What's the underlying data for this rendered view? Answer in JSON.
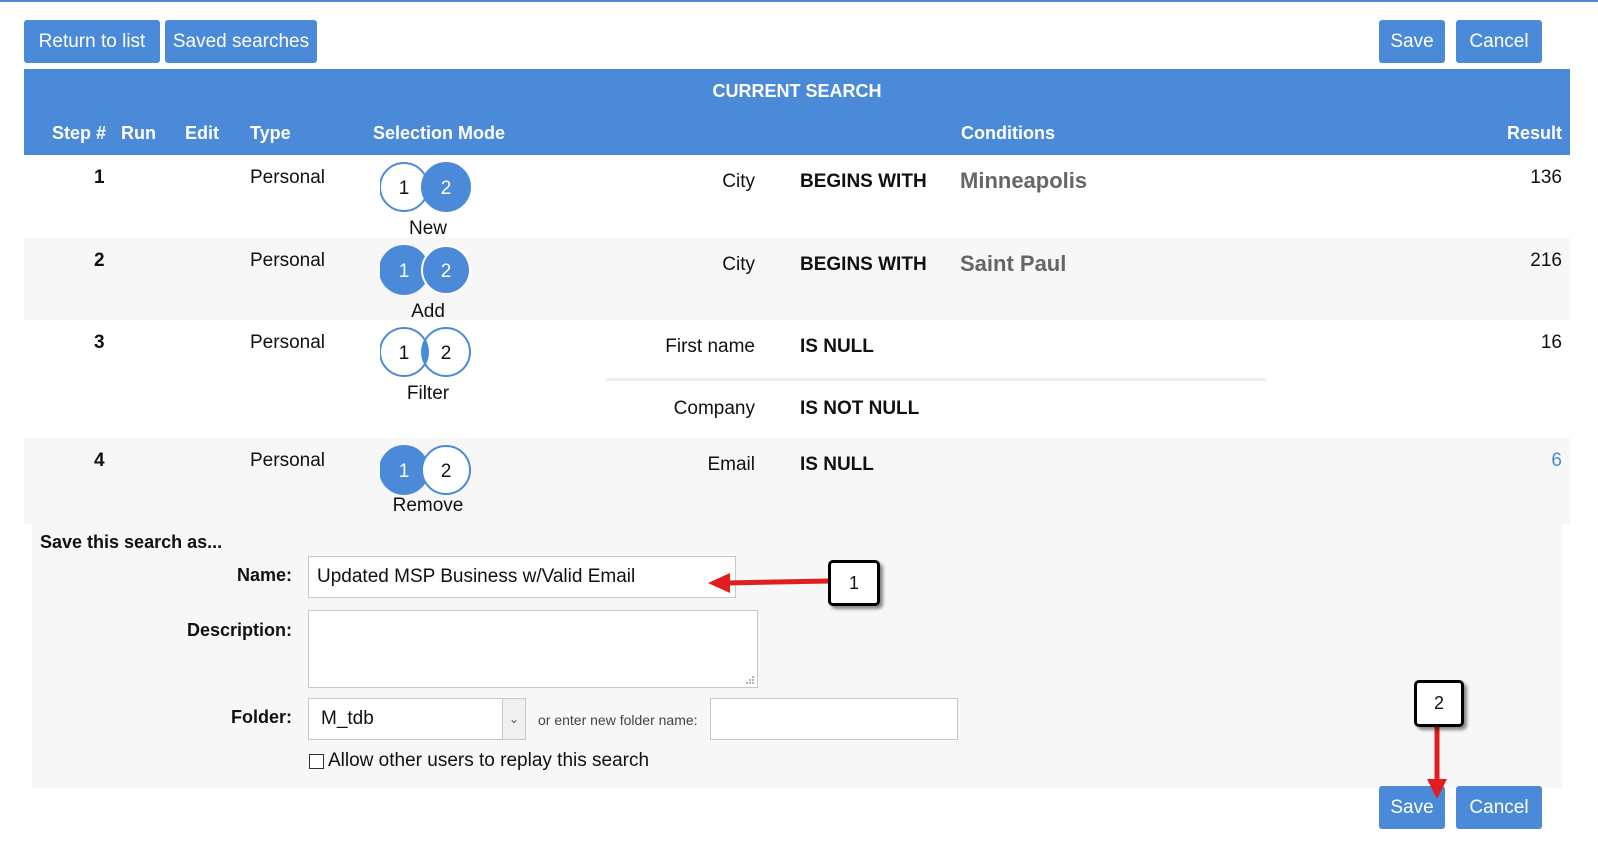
{
  "toolbar": {
    "return_label": "Return to list",
    "saved_label": "Saved searches",
    "save_label": "Save",
    "cancel_label": "Cancel"
  },
  "table": {
    "title": "CURRENT SEARCH",
    "columns": {
      "step": "Step #",
      "run": "Run",
      "edit": "Edit",
      "type": "Type",
      "mode": "Selection Mode",
      "conditions": "Conditions",
      "result": "Result"
    },
    "rows": [
      {
        "step": "1",
        "type": "Personal",
        "mode": "New",
        "conditions": [
          {
            "field": "City",
            "op": "BEGINS WITH",
            "value": "Minneapolis"
          }
        ],
        "result": "136"
      },
      {
        "step": "2",
        "type": "Personal",
        "mode": "Add",
        "conditions": [
          {
            "field": "City",
            "op": "BEGINS WITH",
            "value": "Saint Paul"
          }
        ],
        "result": "216"
      },
      {
        "step": "3",
        "type": "Personal",
        "mode": "Filter",
        "conditions": [
          {
            "field": "First name",
            "op": "IS NULL",
            "value": ""
          },
          {
            "field": "Company",
            "op": "IS NOT NULL",
            "value": ""
          }
        ],
        "result": "16"
      },
      {
        "step": "4",
        "type": "Personal",
        "mode": "Remove",
        "conditions": [
          {
            "field": "Email",
            "op": "IS NULL",
            "value": ""
          }
        ],
        "result": "6"
      }
    ],
    "venn_left": "1",
    "venn_right": "2"
  },
  "save_form": {
    "heading": "Save this search as...",
    "name_label": "Name:",
    "name_value": "Updated MSP Business w/Valid Email",
    "description_label": "Description:",
    "description_value": "",
    "folder_label": "Folder:",
    "folder_value": "M_tdb",
    "new_folder_label": "or enter new folder name:",
    "new_folder_value": "",
    "allow_label": "Allow other users to replay this search",
    "allow_checked": false
  },
  "annotations": {
    "callout_1": "1",
    "callout_2": "2"
  },
  "colors": {
    "accent": "#4a8ad9",
    "arrow": "#e11d1d"
  }
}
